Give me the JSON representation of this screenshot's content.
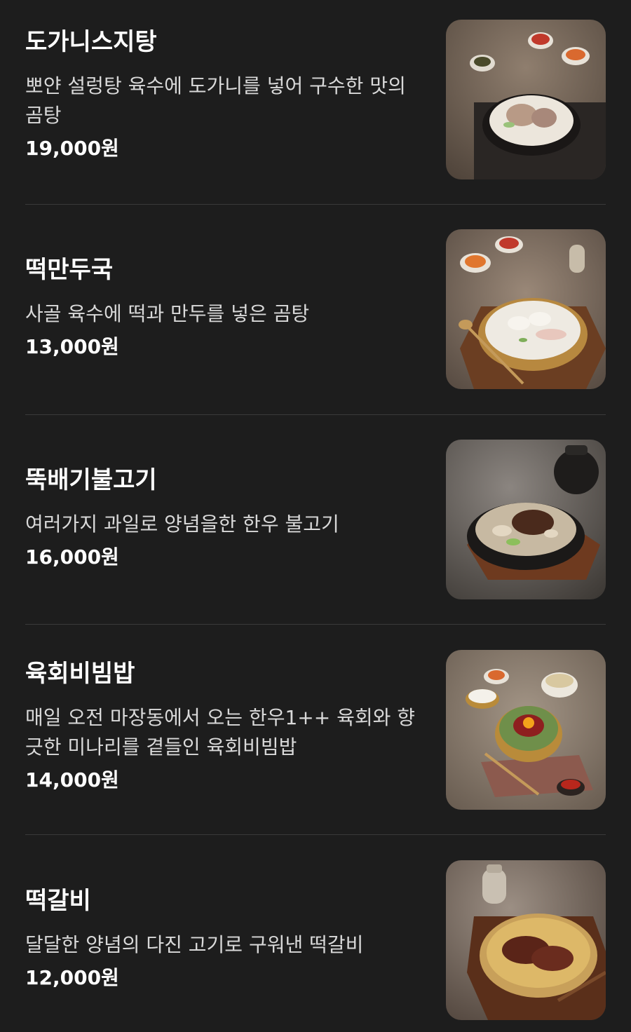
{
  "menu": {
    "items": [
      {
        "name": "도가니스지탕",
        "description": "뽀얀 설렁탕 육수에 도가니를 넣어 구수한 맛의 곰탕",
        "price": "19,000원",
        "image_icon": "gom-tang-bowl-photo"
      },
      {
        "name": "떡만두국",
        "description": "사골 육수에 떡과 만두를 넣은 곰탕",
        "price": "13,000원",
        "image_icon": "dumpling-soup-photo"
      },
      {
        "name": "뚝배기불고기",
        "description": "여러가지 과일로 양념을한 한우 불고기",
        "price": "16,000원",
        "image_icon": "bulgogi-hotpot-photo"
      },
      {
        "name": "육회비빔밥",
        "description": "매일 오전 마장동에서 오는 한우1++ 육회와 향긋한 미나리를 곁들인 육회비빔밥",
        "price": "14,000원",
        "image_icon": "yukhoe-bibimbap-photo"
      },
      {
        "name": "떡갈비",
        "description": "달달한 양념의 다진 고기로 구워낸 떡갈비",
        "price": "12,000원",
        "image_icon": "tteokgalbi-plate-photo"
      }
    ]
  },
  "colors": {
    "background": "#1d1d1d",
    "text_primary": "#ffffff",
    "text_secondary": "#d9d9d9",
    "divider": "#3a3a3a"
  }
}
